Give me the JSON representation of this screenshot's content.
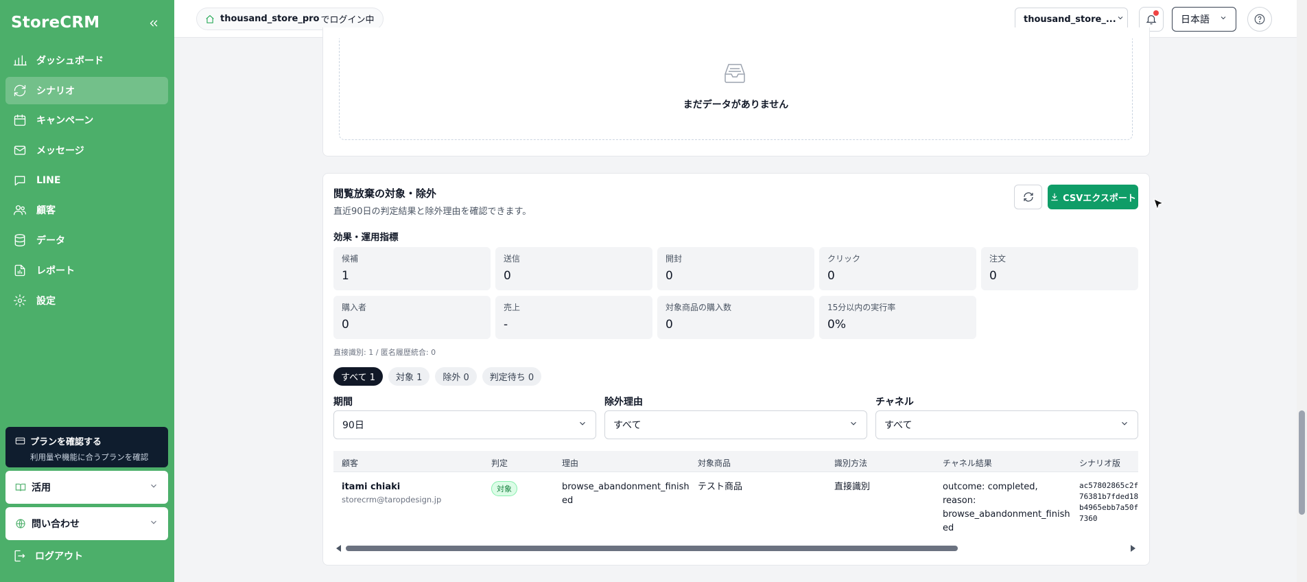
{
  "app": {
    "brand": "StoreCRM"
  },
  "sidebar": {
    "items": [
      {
        "label": "ダッシュボード",
        "icon": "bar-chart-icon"
      },
      {
        "label": "シナリオ",
        "icon": "refresh-cycle-icon",
        "active": true
      },
      {
        "label": "キャンペーン",
        "icon": "calendar-icon"
      },
      {
        "label": "メッセージ",
        "icon": "mail-icon"
      },
      {
        "label": "LINE",
        "icon": "chat-bubble-icon"
      },
      {
        "label": "顧客",
        "icon": "users-icon"
      },
      {
        "label": "データ",
        "icon": "database-icon"
      },
      {
        "label": "レポート",
        "icon": "report-icon"
      },
      {
        "label": "設定",
        "icon": "gear-icon"
      }
    ],
    "plan": {
      "title": "プランを確認する",
      "subtitle": "利用量や機能に合うプランを確認"
    },
    "usage_label": "活用",
    "contact_label": "問い合わせ",
    "logout_label": "ログアウト"
  },
  "header": {
    "login_user": "thousand_store_pro",
    "login_suffix": "でログイン中",
    "store_selected": "thousand_store_...",
    "language": "日本語"
  },
  "empty_state": {
    "text": "まだデータがありません"
  },
  "section": {
    "title": "閲覧放棄の対象・除外",
    "subtitle": "直近90日の判定結果と除外理由を確認できます。",
    "csv_label": "CSVエクスポート",
    "metrics_heading": "効果・運用指標",
    "metrics": [
      {
        "label": "候補",
        "value": "1"
      },
      {
        "label": "送信",
        "value": "0"
      },
      {
        "label": "開封",
        "value": "0"
      },
      {
        "label": "クリック",
        "value": "0"
      },
      {
        "label": "注文",
        "value": "0"
      },
      {
        "label": "購入者",
        "value": "0"
      },
      {
        "label": "売上",
        "value": "-"
      },
      {
        "label": "対象商品の購入数",
        "value": "0"
      },
      {
        "label": "15分以内の実行率",
        "value": "0%"
      }
    ],
    "note": "直接識別: 1 / 匿名履歴統合: 0",
    "chips": [
      {
        "label": "すべて 1",
        "active": true
      },
      {
        "label": "対象 1"
      },
      {
        "label": "除外 0"
      },
      {
        "label": "判定待ち 0"
      }
    ],
    "filters": {
      "period": {
        "label": "期間",
        "value": "90日"
      },
      "reason": {
        "label": "除外理由",
        "value": "すべて"
      },
      "channel": {
        "label": "チャネル",
        "value": "すべて"
      }
    },
    "table": {
      "columns": [
        "顧客",
        "判定",
        "理由",
        "対象商品",
        "識別方法",
        "チャネル結果",
        "シナリオ版"
      ],
      "rows": [
        {
          "customer_name": "itami chiaki",
          "customer_email": "storecrm@taropdesign.jp",
          "judgement": "対象",
          "reason_l1": "browse_abandonment_finish",
          "reason_l2": "ed",
          "product": "テスト商品",
          "method": "直接識別",
          "channel_l1": "outcome: completed,",
          "channel_l2": "reason:",
          "channel_l3": "browse_abandonment_finish",
          "channel_l4": "ed",
          "version_l1": "ac57802865c2f",
          "version_l2": "76381b7fded18",
          "version_l3": "b4965ebb7a50f",
          "version_l4": "7360"
        }
      ]
    }
  },
  "colors": {
    "sidebar": "#4caf6a",
    "primary_button": "#0f9d67",
    "plan_card": "#0f1d2e"
  }
}
